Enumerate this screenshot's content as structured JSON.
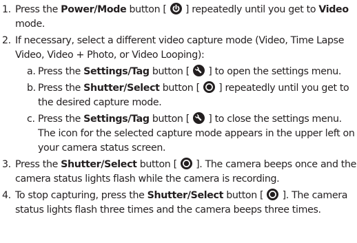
{
  "steps": [
    {
      "num": "1.",
      "t1": "Press the ",
      "b1": "Power/Mode",
      "t2": " button [ ",
      "t3": " ] repeatedly until you get to ",
      "b2": "Video",
      "t4": " mode.",
      "icon": "power-icon"
    },
    {
      "num": "2.",
      "text": "If necessary, select a different video capture mode (Video, Time Lapse Video, Video + Photo, or Video Looping):",
      "substeps": [
        {
          "num": "a.",
          "t1": "Press the ",
          "b1": "Settings/Tag",
          "t2": " button [ ",
          "t3": " ] to open the settings menu.",
          "icon": "wrench-icon"
        },
        {
          "num": "b.",
          "t1": "Press the ",
          "b1": "Shutter/Select",
          "t2": " button [ ",
          "t3": " ] repeatedly until you get to the desired capture mode.",
          "icon": "shutter-icon"
        },
        {
          "num": "c.",
          "t1": "Press the ",
          "b1": "Settings/Tag",
          "t2": " button [ ",
          "t3": " ] to close the settings menu. The icon for the selected capture mode appears in the upper left on your camera status screen.",
          "icon": "wrench-icon"
        }
      ]
    },
    {
      "num": "3.",
      "t1": "Press the ",
      "b1": "Shutter/Select",
      "t2": " button [ ",
      "t3": " ]. The camera beeps once and the camera status lights flash while the camera is recording.",
      "icon": "shutter-icon"
    },
    {
      "num": "4.",
      "t1": "To stop capturing, press the ",
      "b1": "Shutter/Select",
      "t2": " button [ ",
      "t3": " ]. The camera status lights flash three times and the camera beeps three times.",
      "icon": "shutter-icon"
    }
  ]
}
